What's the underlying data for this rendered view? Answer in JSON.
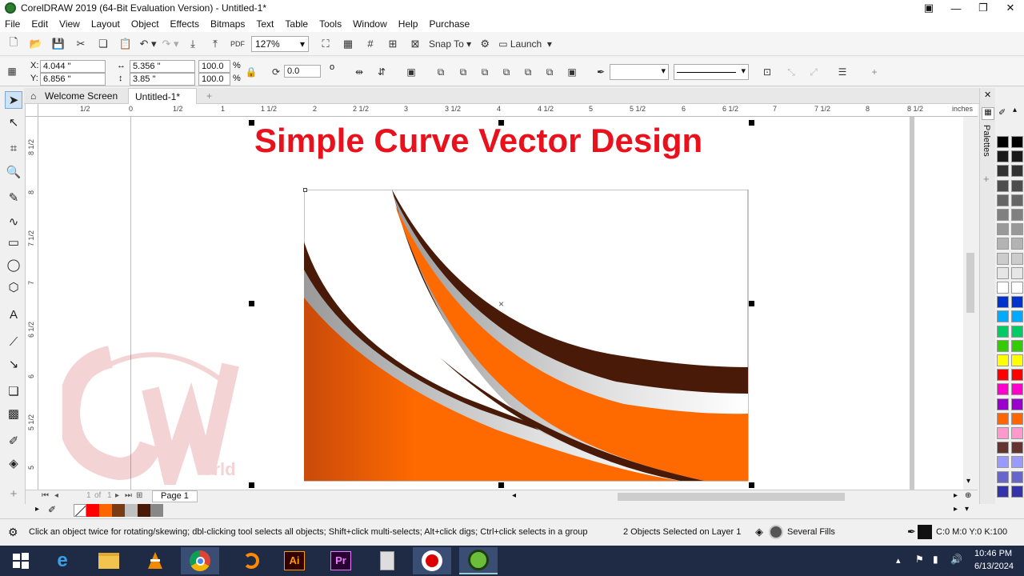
{
  "window": {
    "title": "CorelDRAW 2019 (64-Bit Evaluation Version) - Untitled-1*"
  },
  "menu": [
    "File",
    "Edit",
    "View",
    "Layout",
    "Object",
    "Effects",
    "Bitmaps",
    "Text",
    "Table",
    "Tools",
    "Window",
    "Help",
    "Purchase"
  ],
  "toolbar": {
    "zoom": "127%",
    "snap_to": "Snap To",
    "launch": "Launch"
  },
  "properties": {
    "x": "4.044 \"",
    "y": "6.856 \"",
    "width": "5.356 \"",
    "height": "3.85 \"",
    "scale_x": "100.0",
    "scale_y": "100.0",
    "percent": "%",
    "rotation": "0.0",
    "degree": "o"
  },
  "tabs": {
    "welcome": "Welcome Screen",
    "doc": "Untitled-1*",
    "add": "+"
  },
  "ruler": {
    "h_labels": [
      "1/2",
      "0",
      "1/2",
      "1",
      "1 1/2",
      "2",
      "2 1/2",
      "3",
      "3 1/2",
      "4",
      "4 1/2",
      "5",
      "5 1/2",
      "6",
      "6 1/2",
      "7",
      "7 1/2",
      "8",
      "8 1/2"
    ],
    "units": "inches",
    "v_labels": [
      "8 1/2",
      "8",
      "7 1/2",
      "7",
      "6 1/2",
      "6",
      "5 1/2",
      "5",
      "4 1/2"
    ]
  },
  "canvas": {
    "heading": "Simple Curve Vector Design",
    "watermark_sub": "orld"
  },
  "page_nav": {
    "current": "1",
    "of": "of",
    "total": "1",
    "page_tab": "Page 1"
  },
  "status": {
    "hint": "Click an object twice for rotating/skewing; dbl-clicking tool selects all objects; Shift+click multi-selects; Alt+click digs; Ctrl+click selects in a group",
    "selection": "2 Objects Selected on Layer 1",
    "fill": "Several Fills",
    "outline": "C:0 M:0 Y:0 K:100"
  },
  "dock": {
    "label": "Palettes"
  },
  "palette_swatches": [
    "#000000",
    "#1a1a1a",
    "#333333",
    "#4d4d4d",
    "#666666",
    "#808080",
    "#999999",
    "#b3b3b3",
    "#cccccc",
    "#e6e6e6",
    "#ffffff",
    "#0033cc",
    "#00aaff",
    "#00cc66",
    "#33cc00",
    "#ffff00",
    "#ff0000",
    "#ff00cc",
    "#9900cc",
    "#ff6600",
    "#ff99cc",
    "#663333",
    "#9999ff",
    "#6666cc",
    "#3333aa"
  ],
  "doc_palette": [
    "#ff0000",
    "#ff6600",
    "#7a3b12",
    "#c0c0c0",
    "#4a1a08",
    "#888888"
  ],
  "taskbar": {
    "time": "10:46 PM",
    "date": "6/13/2024"
  },
  "colors": {
    "orange": "#ff6a00",
    "dark_brown": "#4a1a08",
    "heading_red": "#e8111c"
  }
}
